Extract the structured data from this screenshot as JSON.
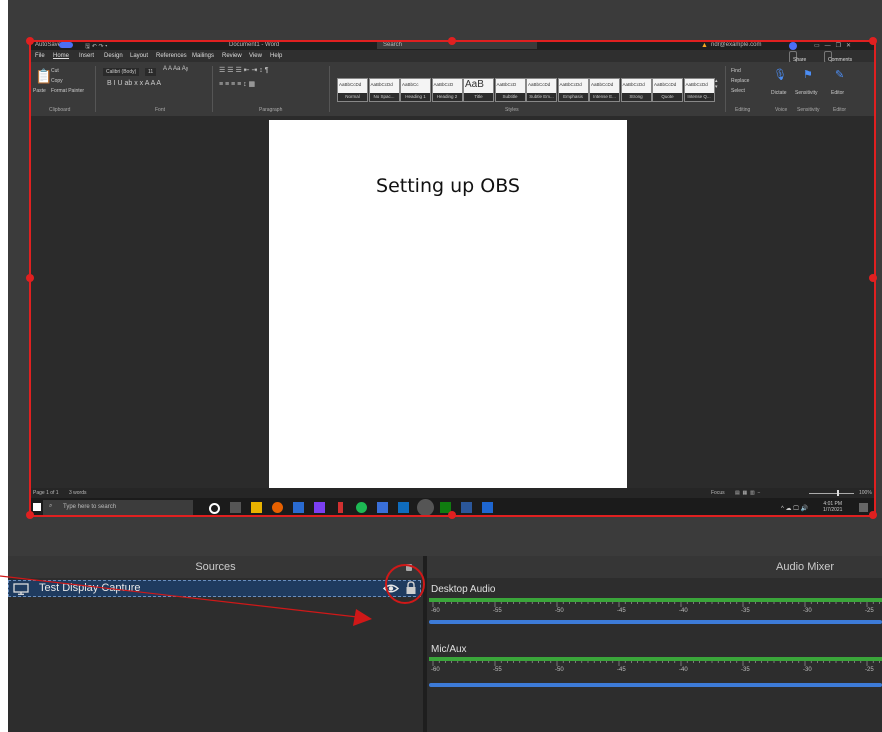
{
  "word": {
    "titlebar": {
      "autosave": "AutoSave",
      "doc_title": "Document1 - Word",
      "search": "Search",
      "account": "ndr@example.com"
    },
    "tabs": [
      "File",
      "Home",
      "Insert",
      "Design",
      "Layout",
      "References",
      "Mailings",
      "Review",
      "View",
      "Help"
    ],
    "share_label": "Share",
    "comments_label": "Comments",
    "ribbon": {
      "clipboard": {
        "paste": "Paste",
        "cut": "Cut",
        "copy": "Copy",
        "format_painter": "Format Painter",
        "label": "Clipboard"
      },
      "font": {
        "name": "Calibri (Body)",
        "size": "11",
        "label": "Font"
      },
      "paragraph_label": "Paragraph",
      "styles": [
        {
          "sample": "AaBbCcDd",
          "name": "Normal"
        },
        {
          "sample": "AaBbCcDd",
          "name": "No Spac..."
        },
        {
          "sample": "AaBbCc",
          "name": "Heading 1"
        },
        {
          "sample": "AaBbCcD",
          "name": "Heading 2"
        },
        {
          "sample": "AaB",
          "name": "Title"
        },
        {
          "sample": "AaBbCcD",
          "name": "Subtitle"
        },
        {
          "sample": "AaBbCcDd",
          "name": "Subtle Em..."
        },
        {
          "sample": "AaBbCcDd",
          "name": "Emphasis"
        },
        {
          "sample": "AaBbCcDd",
          "name": "Intense E..."
        },
        {
          "sample": "AaBbCcDd",
          "name": "Strong"
        },
        {
          "sample": "AaBbCcDd",
          "name": "Quote"
        },
        {
          "sample": "AaBbCcDd",
          "name": "Intense Q..."
        }
      ],
      "styles_label": "Styles",
      "editing": {
        "find": "Find",
        "replace": "Replace",
        "select": "Select",
        "label": "Editing"
      },
      "voice": {
        "dictate": "Dictate",
        "label": "Voice"
      },
      "sensitivity": {
        "name": "Sensitivity",
        "label": "Sensitivity"
      },
      "editor": {
        "name": "Editor",
        "label": "Editor"
      }
    },
    "document": {
      "heading": "Setting up OBS"
    },
    "status": {
      "page": "Page 1 of 1",
      "words": "3 words",
      "focus": "Focus",
      "zoom": "100%"
    }
  },
  "taskbar": {
    "search_placeholder": "Type here to search",
    "time": "4:01 PM",
    "date": "1/7/2021"
  },
  "sources": {
    "title": "Sources",
    "items": [
      {
        "name": "Test Display Capture"
      }
    ]
  },
  "mixer": {
    "title": "Audio Mixer",
    "channels": [
      {
        "name": "Desktop Audio"
      },
      {
        "name": "Mic/Aux"
      }
    ],
    "tick_labels": [
      "-60",
      "-55",
      "-50",
      "-45",
      "-40",
      "-35",
      "-30",
      "-25"
    ]
  },
  "annotations": {
    "highlight": "lock-icon"
  },
  "colors": {
    "selection_border": "#e02020",
    "meter_green": "#3aa53a",
    "fader_blue": "#3d7bd8",
    "annotation_red": "#d01818",
    "source_row_bg": "#1f3b5f"
  }
}
